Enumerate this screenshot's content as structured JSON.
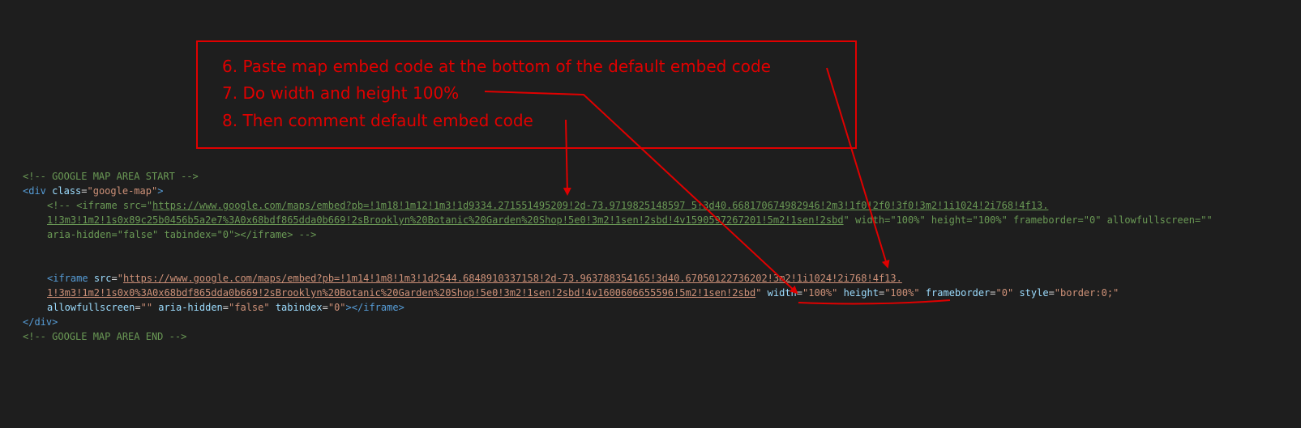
{
  "annotations": {
    "step6": "6. Paste map embed code at the bottom of the default embed code",
    "step7": "7. Do width and height 100%",
    "step8": "8. Then comment default embed code"
  },
  "colors": {
    "annotation": "#e00000",
    "background": "#1e1e1e",
    "comment": "#6a9955",
    "tag": "#569cd6",
    "attribute": "#9cdcfe",
    "string": "#ce9178"
  },
  "code": {
    "comment_start": "<!-- GOOGLE MAP AREA START -->",
    "div_open_a": "<div",
    "div_class_attr": "class",
    "div_eq": "=",
    "div_class_value": "\"google-map\"",
    "div_open_b": ">",
    "old_iframe_prefix": "<!-- <iframe src=\"",
    "old_url_1": "https://www.google.com/maps/embed?pb=!1m18!1m12!1m3!1d9334.271551495209!2d-73.9719825148597 5!3d40.668170674982946!2m3!1f0!2f0!3f0!3m2!1i1024!2i768!4f13.",
    "old_url_2": "1!3m3!1m2!1s0x89c25b0456b5a2e7%3A0x68bdf865dda0b669!2sBrooklyn%20Botanic%20Garden%20Shop!5e0!3m2!1sen!2sbd!4v1590597267201!5m2!1sen!2sbd",
    "old_attrs": "\" width=\"100%\" height=\"100%\" frameborder=\"0\" allowfullscreen=\"\"",
    "old_line3": "aria-hidden=\"false\" tabindex=\"0\"></iframe> -->",
    "new_iframe_tag": "<iframe",
    "src_attr": "src",
    "eq": "=",
    "quote": "\"",
    "new_url_1": "https://www.google.com/maps/embed?pb=!1m14!1m8!1m3!1d2544.6848910337158!2d-73.963788354165!3d40.67050122736202!3m2!1i1024!2i768!4f13.",
    "new_url_2": "1!3m3!1m2!1s0x0%3A0x68bdf865dda0b669!2sBrooklyn%20Botanic%20Garden%20Shop!5e0!3m2!1sen!2sbd!4v1600606655596!5m2!1sen!2sbd",
    "width_attr": "width",
    "width_value": "\"100%\"",
    "height_attr": "height",
    "height_value": "\"100%\"",
    "frameborder_attr": "frameborder",
    "frameborder_value": "\"0\"",
    "style_attr": "style",
    "style_value": "\"border:0;\"",
    "allowfullscreen_attr": "allowfullscreen",
    "allowfullscreen_value": "\"\"",
    "aria_hidden_attr": "aria-hidden",
    "aria_hidden_value": "\"false\"",
    "tabindex_attr": "tabindex",
    "tabindex_value": "\"0\"",
    "tag_close": ">",
    "iframe_close": "</iframe>",
    "div_close": "</div>",
    "comment_end": "<!-- GOOGLE MAP AREA END -->"
  }
}
